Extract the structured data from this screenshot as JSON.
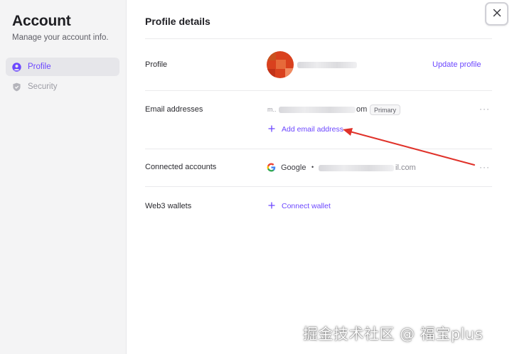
{
  "sidebar": {
    "title": "Account",
    "subtitle": "Manage your account info.",
    "items": [
      {
        "label": "Profile",
        "active": true,
        "icon": "user-circle-icon"
      },
      {
        "label": "Security",
        "active": false,
        "icon": "shield-icon"
      }
    ]
  },
  "close": {
    "icon": "close-icon"
  },
  "main": {
    "title": "Profile details",
    "profile": {
      "label": "Profile",
      "update_label": "Update profile"
    },
    "email": {
      "label": "Email addresses",
      "address_start": "m..",
      "address_end": "om",
      "badge": "Primary",
      "add_label": "Add email address"
    },
    "connected": {
      "label": "Connected accounts",
      "provider": "Google",
      "separator": "•",
      "account_end": "il.com"
    },
    "web3": {
      "label": "Web3 wallets",
      "connect_label": "Connect wallet"
    },
    "more_label": "···"
  },
  "watermark": "掘金技术社区 @ 福宝plus",
  "colors": {
    "accent": "#6c47ff",
    "annotation_arrow": "#e0322a",
    "sidebar_bg": "#f4f4f5",
    "avatar": "#d9411e"
  }
}
